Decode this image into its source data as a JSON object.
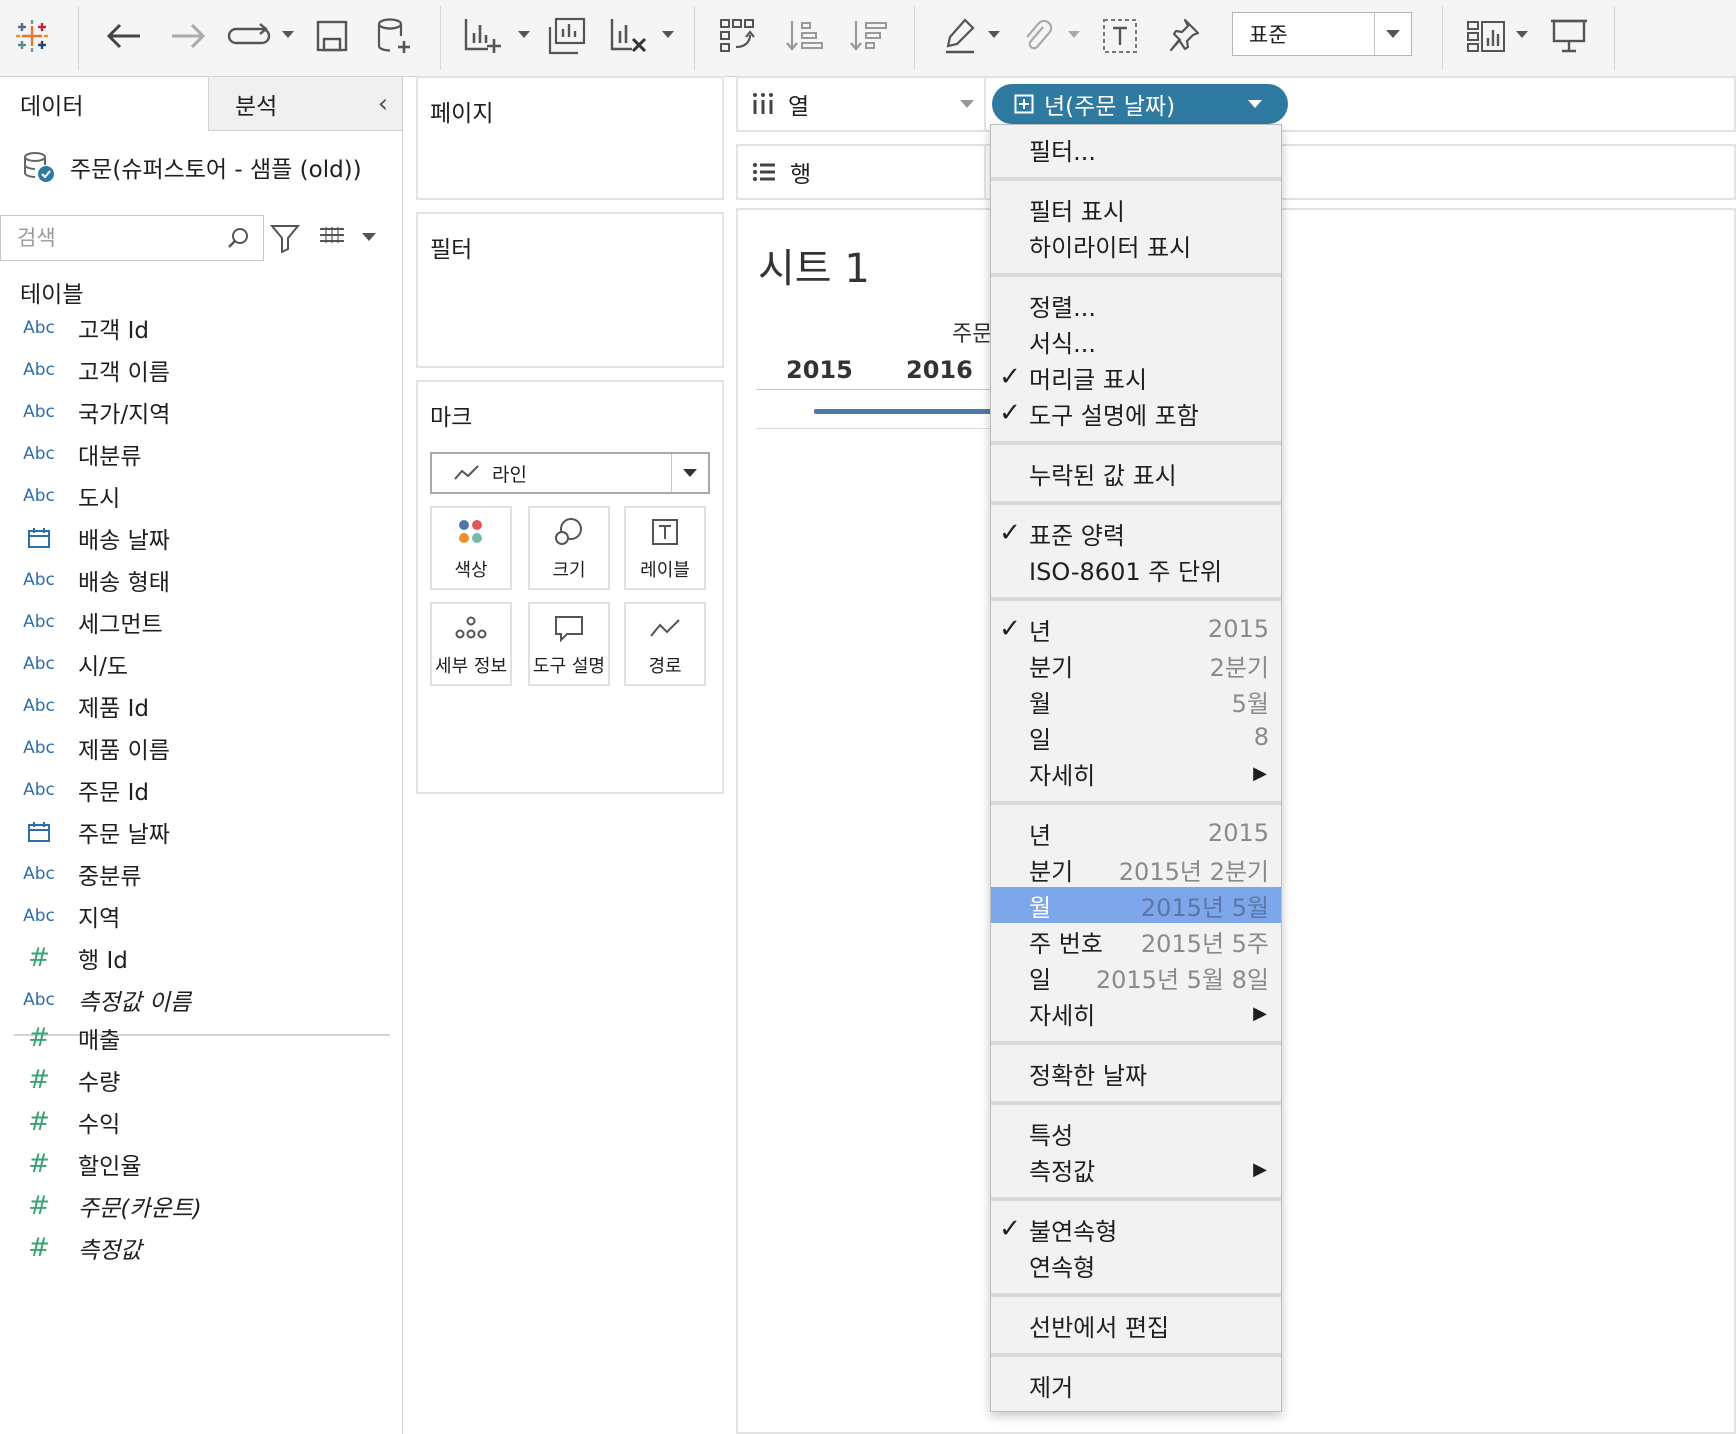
{
  "toolbar": {
    "standard_select": "표준"
  },
  "data_pane": {
    "tab_data": "데이터",
    "tab_analysis": "분석",
    "datasource": "주문(슈퍼스토어 - 샘플 (old))",
    "search_placeholder": "검색",
    "tables_title": "테이블",
    "fields": [
      {
        "type": "Abc",
        "name": "고객 Id"
      },
      {
        "type": "Abc",
        "name": "고객 이름"
      },
      {
        "type": "Abc",
        "name": "국가/지역"
      },
      {
        "type": "Abc",
        "name": "대분류"
      },
      {
        "type": "Abc",
        "name": "도시"
      },
      {
        "type": "date",
        "name": "배송 날짜"
      },
      {
        "type": "Abc",
        "name": "배송 형태"
      },
      {
        "type": "Abc",
        "name": "세그먼트"
      },
      {
        "type": "Abc",
        "name": "시/도"
      },
      {
        "type": "Abc",
        "name": "제품 Id"
      },
      {
        "type": "Abc",
        "name": "제품 이름"
      },
      {
        "type": "Abc",
        "name": "주문 Id"
      },
      {
        "type": "date",
        "name": "주문 날짜"
      },
      {
        "type": "Abc",
        "name": "중분류"
      },
      {
        "type": "Abc",
        "name": "지역"
      },
      {
        "type": "#",
        "name": "행 Id"
      },
      {
        "type": "Abc",
        "name": "측정값 이름"
      }
    ],
    "measures": [
      {
        "type": "#",
        "name": "매출"
      },
      {
        "type": "#",
        "name": "수량"
      },
      {
        "type": "#",
        "name": "수익"
      },
      {
        "type": "#",
        "name": "할인율"
      },
      {
        "type": "#",
        "name": "주문(카운트)"
      },
      {
        "type": "#",
        "name": "측정값"
      }
    ]
  },
  "shelves": {
    "pages": "페이지",
    "filters": "필터",
    "marks": "마크",
    "marks_type": "라인",
    "mark_buttons": [
      "색상",
      "크기",
      "레이블",
      "세부 정보",
      "도구 설명",
      "경로"
    ],
    "columns": "열",
    "rows": "행",
    "pill": "년(주문 날짜)"
  },
  "view": {
    "sheet_title": "시트 1",
    "header_title": "주문",
    "years": [
      "2015",
      "2016"
    ]
  },
  "menu": {
    "items": [
      {
        "label": "필터...",
        "checked": false
      },
      {
        "label": "필터 표시",
        "checked": false
      },
      {
        "label": "하이라이터 표시",
        "checked": false
      },
      {
        "label": "정렬...",
        "checked": false
      },
      {
        "label": "서식...",
        "checked": false
      },
      {
        "label": "머리글 표시",
        "checked": true
      },
      {
        "label": "도구 설명에 포함",
        "checked": true
      },
      {
        "label": "누락된 값 표시",
        "checked": false
      },
      {
        "label": "표준 양력",
        "checked": true
      },
      {
        "label": "ISO-8601 주 단위",
        "checked": false
      },
      {
        "label": "년",
        "value": "2015",
        "checked": true
      },
      {
        "label": "분기",
        "value": "2분기",
        "checked": false
      },
      {
        "label": "월",
        "value": "5월",
        "checked": false
      },
      {
        "label": "일",
        "value": "8",
        "checked": false
      },
      {
        "label": "자세히",
        "submenu": true
      },
      {
        "label": "년",
        "value": "2015",
        "checked": false
      },
      {
        "label": "분기",
        "value": "2015년 2분기",
        "checked": false
      },
      {
        "label": "월",
        "value": "2015년 5월",
        "checked": false,
        "highlighted": true
      },
      {
        "label": "주 번호",
        "value": "2015년 5주",
        "checked": false
      },
      {
        "label": "일",
        "value": "2015년 5월 8일",
        "checked": false
      },
      {
        "label": "자세히",
        "submenu": true
      },
      {
        "label": "정확한 날짜",
        "checked": false
      },
      {
        "label": "특성",
        "checked": false
      },
      {
        "label": "측정값",
        "submenu": true
      },
      {
        "label": "불연속형",
        "checked": true
      },
      {
        "label": "연속형",
        "checked": false
      },
      {
        "label": "선반에서 편집",
        "checked": false
      },
      {
        "label": "제거",
        "checked": false
      }
    ]
  },
  "colors": {
    "pill": "#2f7aa1",
    "highlight": "#7ea6ea",
    "data_line": "#4e79a7",
    "dimension_icon": "#2f6fa7",
    "measure_icon": "#3aa374"
  }
}
